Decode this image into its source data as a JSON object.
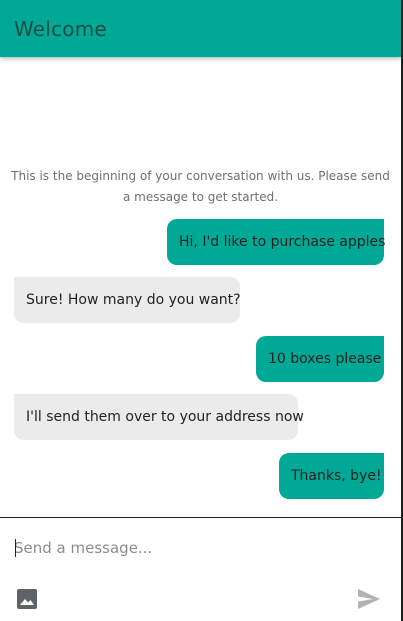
{
  "header": {
    "title": "Welcome"
  },
  "conversation": {
    "intro": "This is the beginning of your conversation with us. Please send a message to get started.",
    "messages": [
      {
        "direction": "out",
        "text": "Hi, I'd like to purchase apples"
      },
      {
        "direction": "in",
        "text": "Sure! How many do you want?"
      },
      {
        "direction": "out",
        "text": "10 boxes please"
      },
      {
        "direction": "in",
        "text": "I'll send them over to your address now"
      },
      {
        "direction": "out",
        "text": "Thanks, bye!"
      }
    ]
  },
  "composer": {
    "placeholder": "Send a message...",
    "value": "",
    "attach_icon": "image-icon",
    "send_icon": "send-icon"
  },
  "colors": {
    "accent": "#00a896",
    "incoming_bubble": "#ebebeb",
    "header_text": "#1d4d47"
  }
}
